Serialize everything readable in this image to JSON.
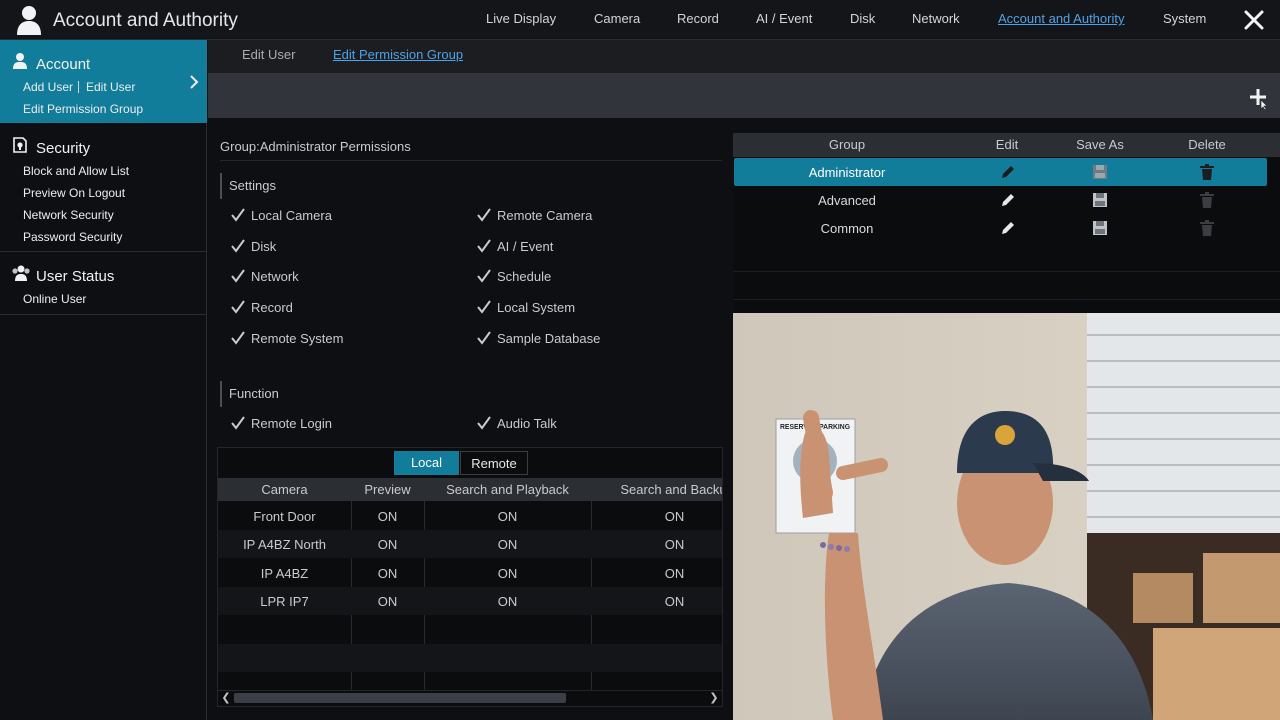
{
  "app": {
    "title": "Account and Authority"
  },
  "topnav": [
    "Live Display",
    "Camera",
    "Record",
    "AI / Event",
    "Disk",
    "Network",
    "Account and Authority",
    "System"
  ],
  "sidebar": {
    "account": {
      "title": "Account",
      "add_user": "Add User",
      "edit_user": "Edit User",
      "edit_permission_group": "Edit Permission Group"
    },
    "security": {
      "title": "Security",
      "items": [
        "Block and Allow List",
        "Preview On Logout",
        "Network Security",
        "Password Security"
      ]
    },
    "user_status": {
      "title": "User Status",
      "items": [
        "Online User"
      ]
    }
  },
  "subtabs": [
    "Edit User",
    "Edit Permission Group"
  ],
  "group_label": "Group:Administrator Permissions",
  "settings": {
    "title": "Settings",
    "left": [
      "Local Camera",
      "Disk",
      "Network",
      "Record",
      "Remote System"
    ],
    "right": [
      "Remote Camera",
      "AI / Event",
      "Schedule",
      "Local System",
      "Sample Database"
    ]
  },
  "function": {
    "title": "Function",
    "left": [
      "Remote Login"
    ],
    "right": [
      "Audio Talk"
    ]
  },
  "camera_tabs": {
    "local": "Local",
    "remote": "Remote"
  },
  "camera_table": {
    "headers": [
      "Camera",
      "Preview",
      "Search and Playback",
      "Search and Backu"
    ],
    "rows": [
      [
        "Front Door",
        "ON",
        "ON",
        "ON"
      ],
      [
        "IP A4BZ North",
        "ON",
        "ON",
        "ON"
      ],
      [
        "IP A4BZ",
        "ON",
        "ON",
        "ON"
      ],
      [
        "LPR IP7",
        "ON",
        "ON",
        "ON"
      ]
    ]
  },
  "group_table": {
    "headers": [
      "Group",
      "Edit",
      "Save As",
      "Delete"
    ],
    "rows": [
      "Administrator",
      "Advanced",
      "Common"
    ],
    "selected": "Administrator"
  },
  "video_sign": "RESERVED PARKING",
  "colors": {
    "accent": "#127c9b",
    "link": "#4ea3e8",
    "background": "#0e0f12"
  },
  "icons": [
    "user-icon",
    "close-icon",
    "chevron-right-icon",
    "shield-icon",
    "users-icon",
    "plus-icon",
    "check-icon",
    "pencil-icon",
    "save-icon",
    "trash-icon"
  ]
}
